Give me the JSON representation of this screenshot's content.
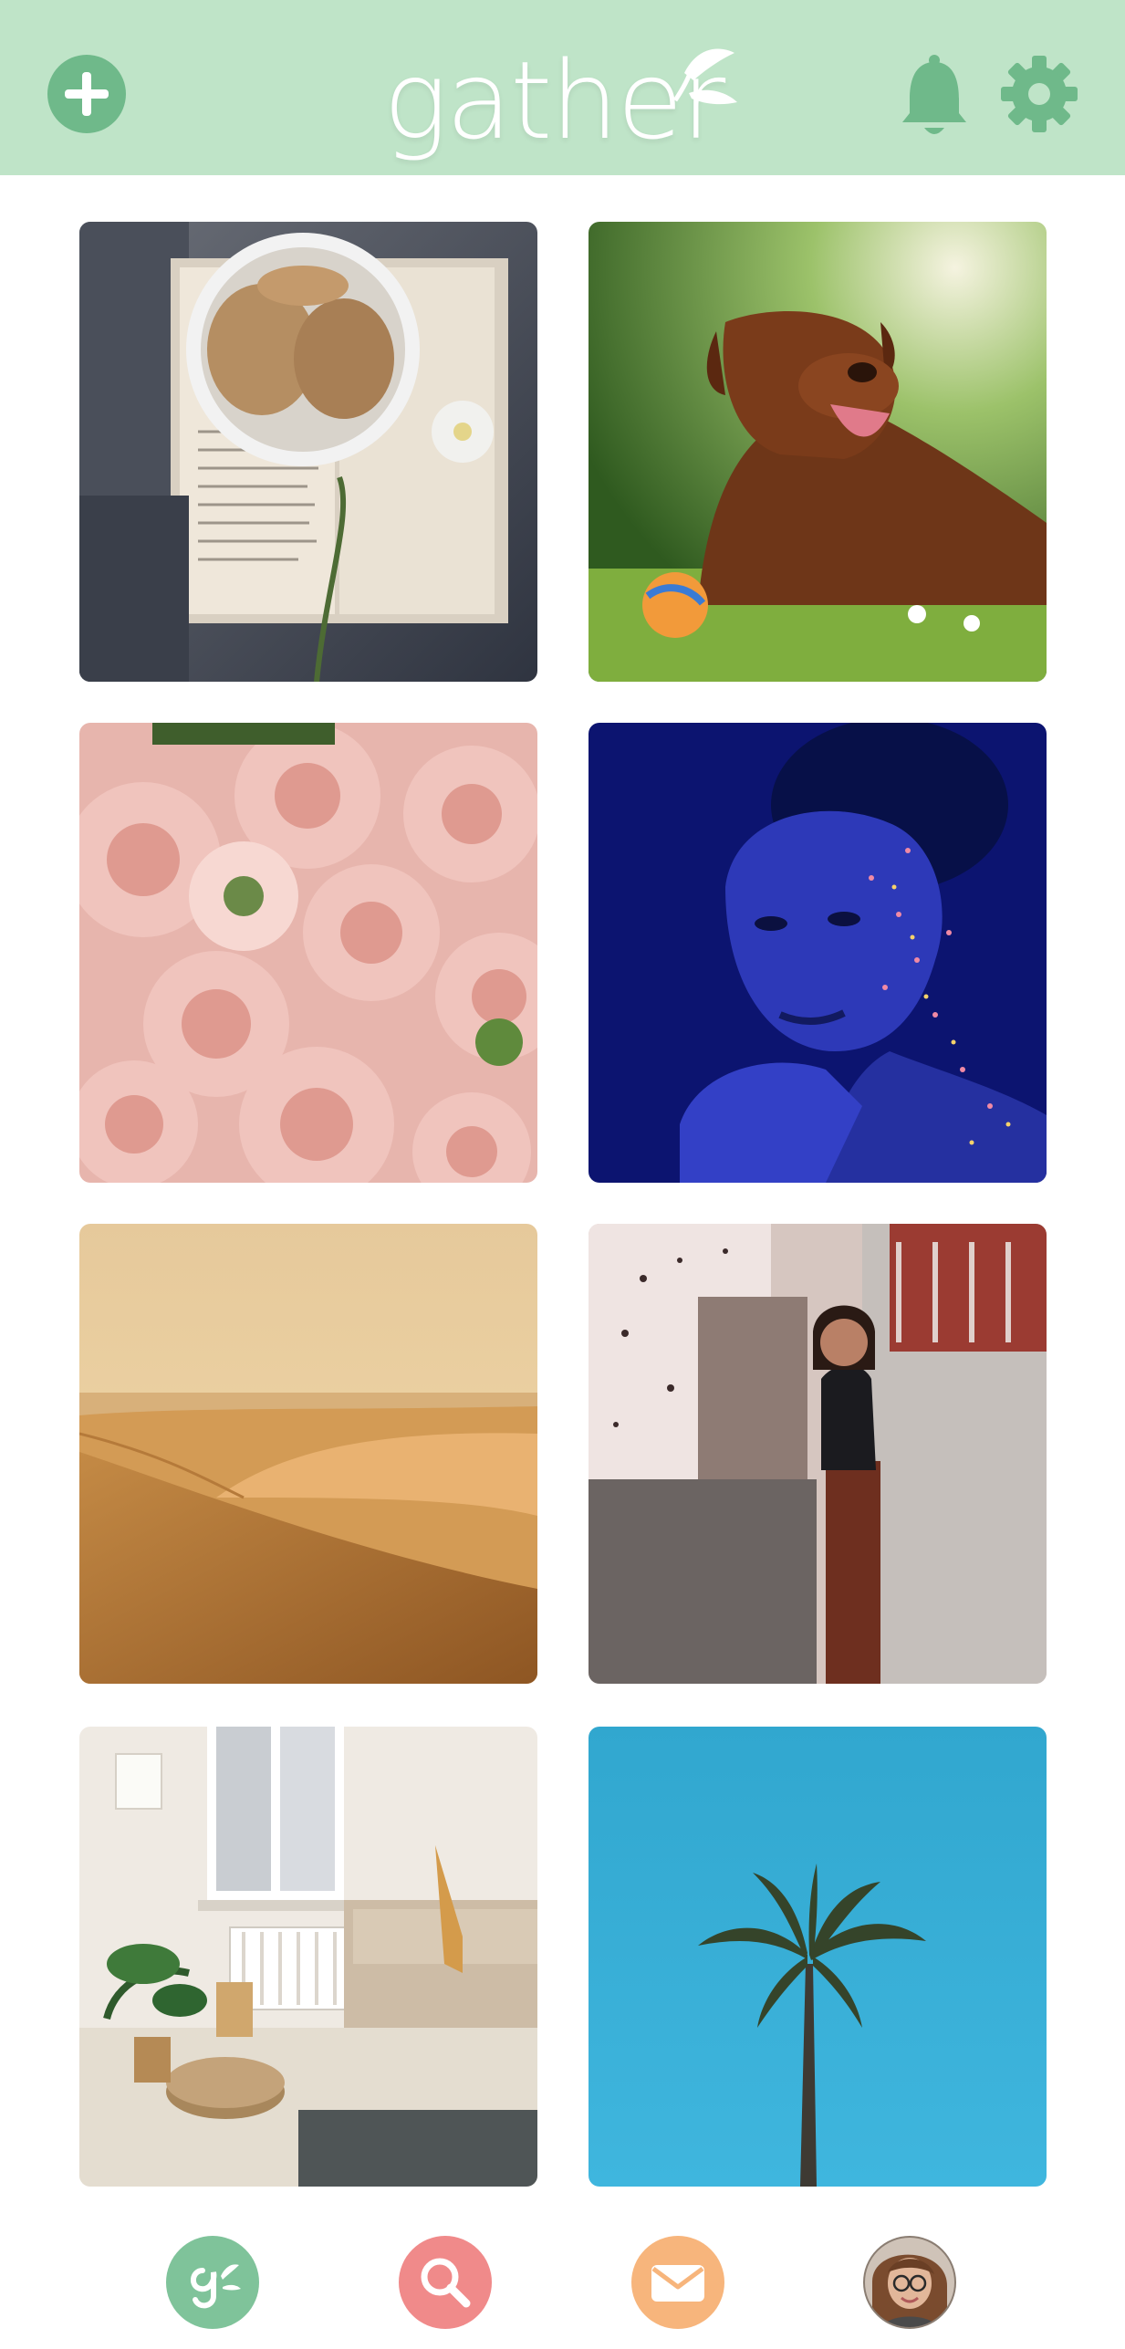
{
  "header": {
    "logo_text": "gather",
    "add_button_icon": "plus-icon",
    "notifications_icon": "bell-icon",
    "settings_icon": "gear-icon"
  },
  "feed": {
    "tiles": [
      {
        "name": "cookies-book-photo"
      },
      {
        "name": "dog-on-grass-photo"
      },
      {
        "name": "pink-roses-photo"
      },
      {
        "name": "blue-portrait-photo"
      },
      {
        "name": "desert-dunes-photo"
      },
      {
        "name": "woman-by-wall-photo"
      },
      {
        "name": "cozy-room-photo"
      },
      {
        "name": "palm-tree-sky-photo"
      }
    ]
  },
  "bottom_nav": {
    "items": [
      {
        "name": "home",
        "icon": "gather-logo-icon",
        "color": "#7fc39a"
      },
      {
        "name": "search",
        "icon": "search-icon",
        "color": "#f08a8a"
      },
      {
        "name": "messages",
        "icon": "mail-icon",
        "color": "#f7b57c"
      },
      {
        "name": "profile",
        "icon": "avatar",
        "color": "#c9a080"
      }
    ]
  },
  "colors": {
    "header_bg": "#bfe4c8",
    "accent_green": "#6fb98a"
  }
}
